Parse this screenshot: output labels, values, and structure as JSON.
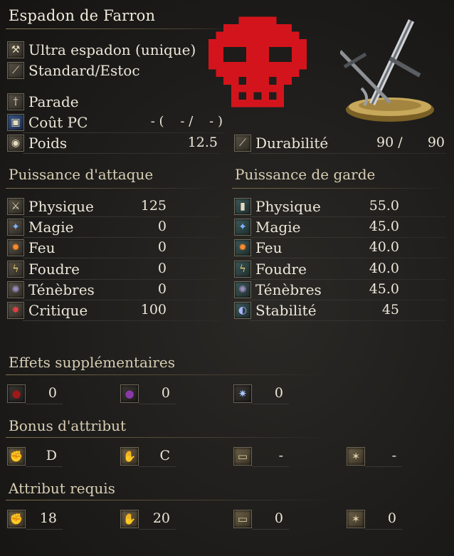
{
  "weapon_name": "Espadon de Farron",
  "info": {
    "type": "Ultra espadon (unique)",
    "attack_type": "Standard/Estoc",
    "skill": "Parade",
    "fp_cost_label": "Coût PC",
    "fp_cost_value": "- (    - /    - )",
    "weight_label": "Poids",
    "weight_value": "12.5",
    "durability_label": "Durabilité",
    "durability_current": "90 /",
    "durability_max": "90"
  },
  "attack": {
    "header": "Puissance d'attaque",
    "rows": [
      {
        "label": "Physique",
        "value": "125",
        "icon": "sword-icon"
      },
      {
        "label": "Magie",
        "value": "0",
        "icon": "magic-icon"
      },
      {
        "label": "Feu",
        "value": "0",
        "icon": "fire-icon"
      },
      {
        "label": "Foudre",
        "value": "0",
        "icon": "lightning-icon"
      },
      {
        "label": "Ténèbres",
        "value": "0",
        "icon": "dark-icon"
      },
      {
        "label": "Critique",
        "value": "100",
        "icon": "critical-icon"
      }
    ]
  },
  "guard": {
    "header": "Puissance de garde",
    "rows": [
      {
        "label": "Physique",
        "value": "55.0",
        "icon": "shield-physical-icon"
      },
      {
        "label": "Magie",
        "value": "45.0",
        "icon": "shield-magic-icon"
      },
      {
        "label": "Feu",
        "value": "40.0",
        "icon": "shield-fire-icon"
      },
      {
        "label": "Foudre",
        "value": "40.0",
        "icon": "shield-lightning-icon"
      },
      {
        "label": "Ténèbres",
        "value": "45.0",
        "icon": "shield-dark-icon"
      },
      {
        "label": "Stabilité",
        "value": "45",
        "icon": "stability-icon"
      }
    ]
  },
  "effects": {
    "header": "Effets supplémentaires",
    "items": [
      {
        "icon": "bleed-icon",
        "value": "0",
        "color": "#a01818"
      },
      {
        "icon": "poison-icon",
        "value": "0",
        "color": "#8a3aa8"
      },
      {
        "icon": "frost-icon",
        "value": "0",
        "color": "#a8c8ff"
      }
    ]
  },
  "scaling": {
    "header": "Bonus d'attribut",
    "items": [
      {
        "icon": "strength-icon",
        "value": "D"
      },
      {
        "icon": "dexterity-icon",
        "value": "C"
      },
      {
        "icon": "intelligence-icon",
        "value": "-"
      },
      {
        "icon": "faith-icon",
        "value": "-"
      }
    ]
  },
  "requirements": {
    "header": "Attribut requis",
    "items": [
      {
        "icon": "strength-icon",
        "value": "18"
      },
      {
        "icon": "dexterity-icon",
        "value": "20"
      },
      {
        "icon": "intelligence-icon",
        "value": "0"
      },
      {
        "icon": "faith-icon",
        "value": "0"
      }
    ]
  },
  "colors": {
    "skull": "#d4141c",
    "text": "#ece7d9",
    "section": "#d8ceb4"
  }
}
